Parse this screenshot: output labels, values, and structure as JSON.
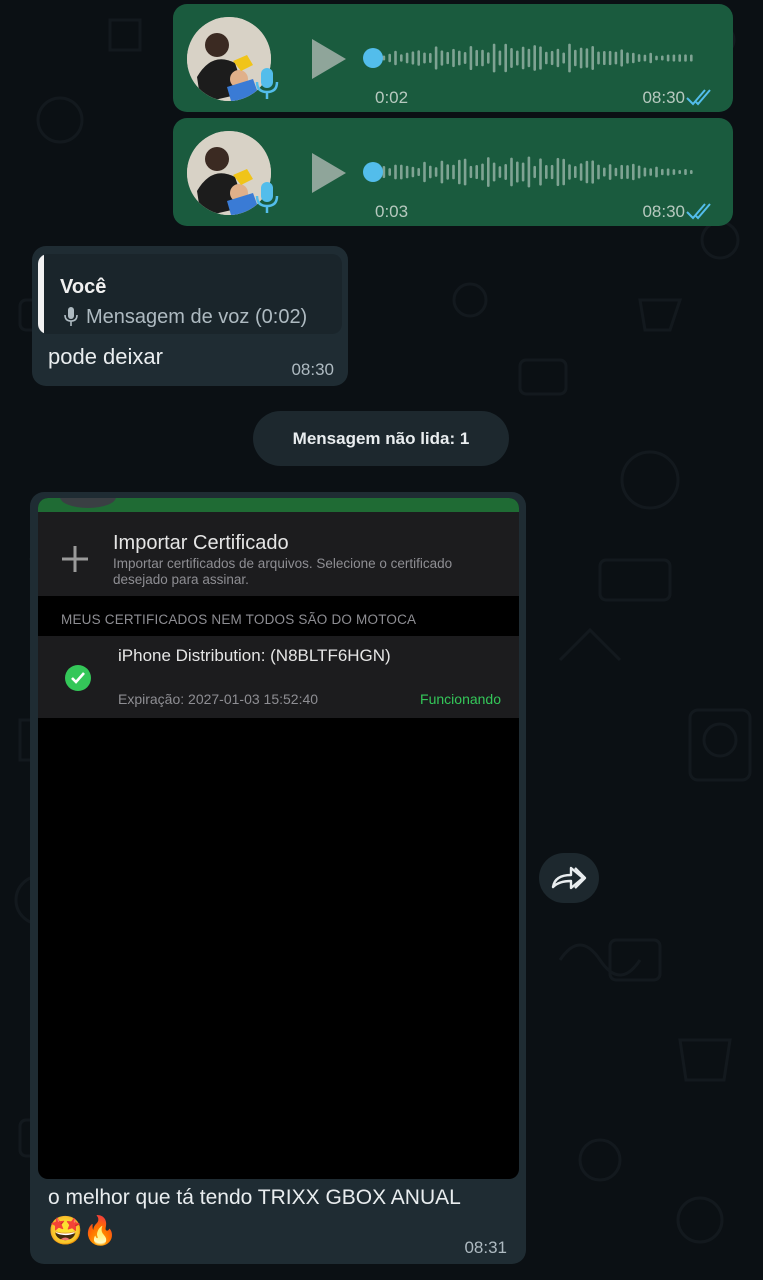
{
  "messages": {
    "voice_1": {
      "duration": "0:02",
      "time": "08:30",
      "progress": 0.0
    },
    "voice_2": {
      "duration": "0:03",
      "time": "08:30",
      "progress": 0.0
    },
    "reply": {
      "quoted_author": "Você",
      "quoted_text": "Mensagem de voz (0:02)",
      "text": "pode deixar",
      "time": "08:30"
    },
    "unread_banner": "Mensagem não lida: 1",
    "image_message": {
      "screenshot": {
        "import_title": "Importar Certificado",
        "import_desc": "Importar certificados de arquivos. Selecione o certificado desejado para assinar.",
        "section_header": "MEUS CERTIFICADOS NEM TODOS SÃO DO MOTOCA",
        "cert_name": "iPhone Distribution:  (N8BLTF6HGN)",
        "cert_expiry": "Expiração: 2027-01-03 15:52:40",
        "cert_status": "Funcionando"
      },
      "caption": "o melhor que tá tendo TRIXX GBOX ANUAL",
      "emoji": "🤩🔥",
      "time": "08:31"
    }
  },
  "icons": {
    "play": "play-icon",
    "mic": "microphone-icon",
    "read": "double-check-icon",
    "forward": "forward-icon",
    "plus": "plus-icon",
    "check": "check-circle-icon"
  },
  "colors": {
    "background": "#0b1014",
    "outgoing_bubble": "#1a5b3e",
    "incoming_bubble": "#1f2c33",
    "accent_blue": "#53bdeb",
    "status_green": "#34c759"
  }
}
